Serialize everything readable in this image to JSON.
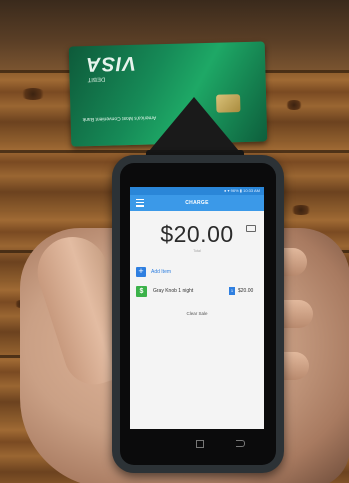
{
  "card": {
    "brand": "VISA",
    "sub": "DEBIT",
    "bank": "America's Most Convenient Bank"
  },
  "app": {
    "status_text": "● ▾ 96% ▮ 10:33 AM",
    "title": "CHARGE",
    "amount": "$20.00",
    "amount_caption": "Total",
    "add_item_label": "Add Item",
    "item": {
      "icon_text": "$",
      "name": "Gray Knob 1 night",
      "quantity": "1",
      "price": "$20.00"
    },
    "clear_sale_label": "Clear Sale"
  },
  "colors": {
    "appbar": "#3b99e8",
    "accent": "#2f7fe0",
    "item_icon": "#3bb24a",
    "card": "#168a57"
  },
  "icons": [
    "menu-icon",
    "keypad-icon",
    "plus-icon",
    "dollar-icon",
    "back-icon",
    "recent-apps-icon"
  ]
}
